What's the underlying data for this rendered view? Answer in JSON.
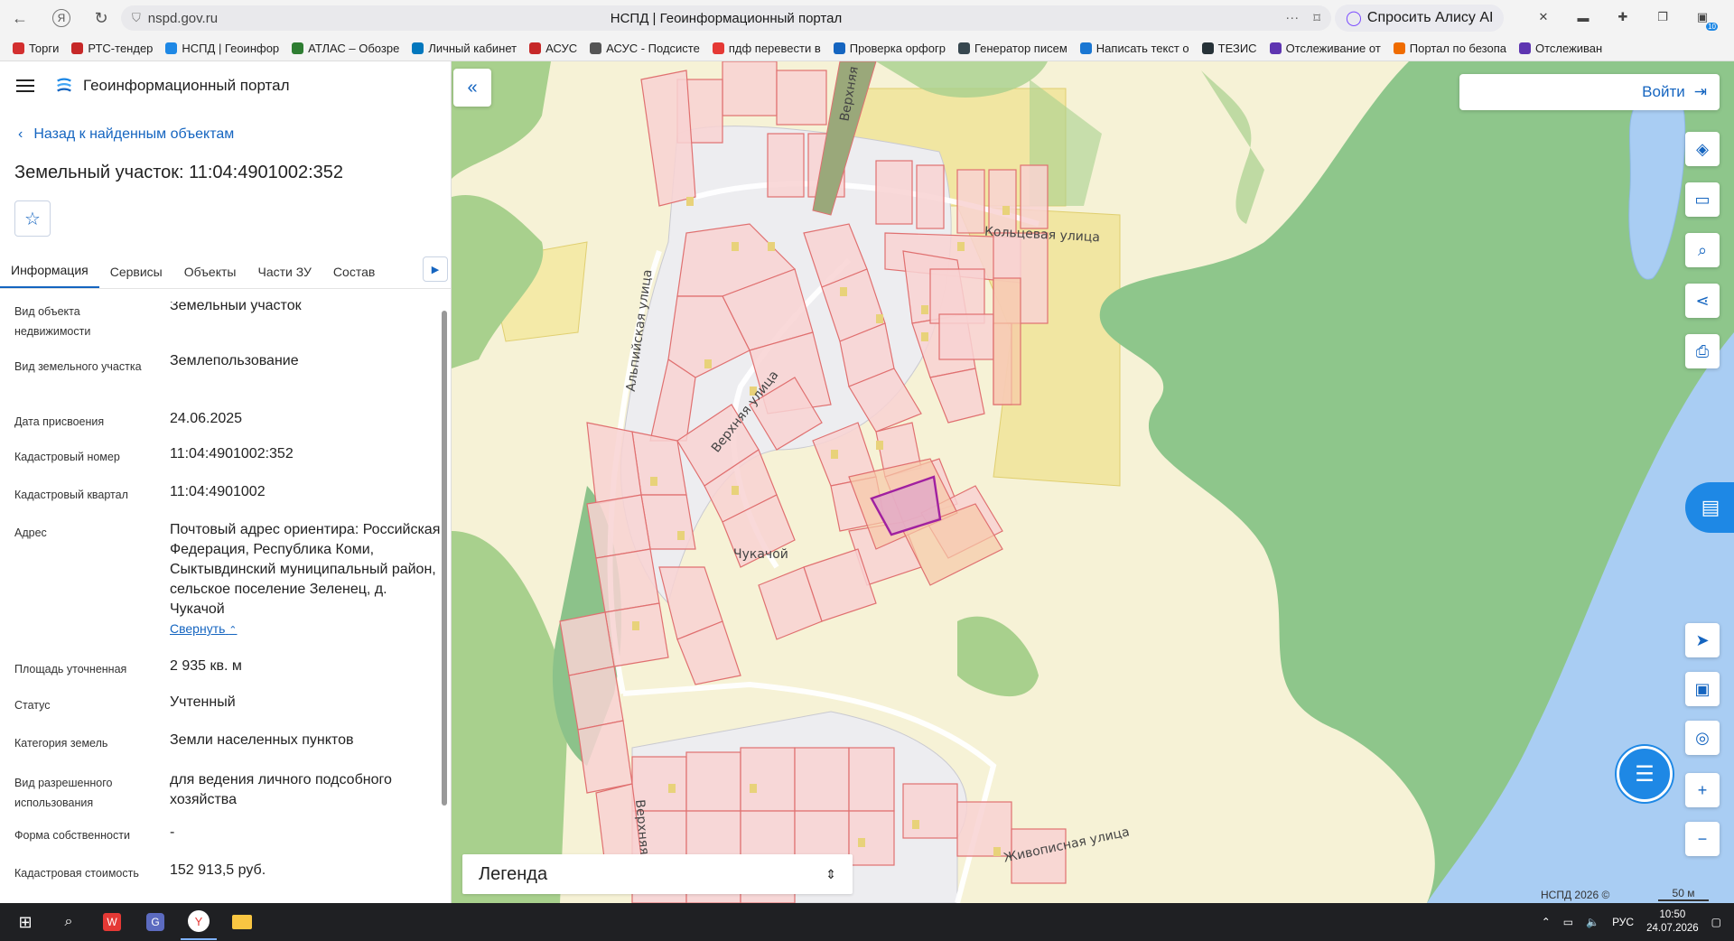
{
  "browser": {
    "url": "nspd.gov.ru",
    "tab_title": "НСПД | Геоинформационный портал",
    "alice_label": "Спросить Алису AI",
    "ext_badge": "10"
  },
  "bookmarks": [
    {
      "label": "Торги",
      "color": "#d32f2f"
    },
    {
      "label": "РТС-тендер",
      "color": "#c62828"
    },
    {
      "label": "НСПД | Геоинфор",
      "color": "#1e88e5"
    },
    {
      "label": "АТЛАС – Обозре",
      "color": "#2e7d32"
    },
    {
      "label": "Личный кабинет",
      "color": "#0277bd"
    },
    {
      "label": "АСУС",
      "color": "#c62828"
    },
    {
      "label": "АСУС - Подсисте",
      "color": "#555555"
    },
    {
      "label": "пдф перевести в",
      "color": "#e53935"
    },
    {
      "label": "Проверка орфогр",
      "color": "#1565c0"
    },
    {
      "label": "Генератор писем",
      "color": "#37474f"
    },
    {
      "label": "Написать текст о",
      "color": "#1976d2"
    },
    {
      "label": "ТЕЗИС",
      "color": "#263238"
    },
    {
      "label": "Отслеживание от",
      "color": "#5e35b1"
    },
    {
      "label": "Портал по безопа",
      "color": "#ef6c00"
    },
    {
      "label": "Отслеживан",
      "color": "#5e35b1"
    }
  ],
  "portal": {
    "title": "Геоинформационный портал",
    "back_label": "Назад к найденным объектам",
    "object_title": "Земельный участок: 11:04:4901002:352"
  },
  "tabs": [
    "Информация",
    "Сервисы",
    "Объекты",
    "Части ЗУ",
    "Состав"
  ],
  "info": {
    "rows": [
      {
        "label": "Вид объекта недвижимости",
        "value": "Земельный участок"
      },
      {
        "label": "Вид земельного участка",
        "value": "Землепользование"
      },
      {
        "label": "Дата присвоения",
        "value": "24.06.2025"
      },
      {
        "label": "Кадастровый номер",
        "value": "11:04:4901002:352"
      },
      {
        "label": "Кадастровый квартал",
        "value": "11:04:4901002"
      },
      {
        "label": "Адрес",
        "value": "Почтовый адрес ориентира: Российская Федерация, Республика Коми, Сыктывдинский муниципальный район, сельское поселение Зеленец, д. Чукачой"
      },
      {
        "label": "Площадь уточненная",
        "value": "2 935 кв. м"
      },
      {
        "label": "Статус",
        "value": "Учтенный"
      },
      {
        "label": "Категория земель",
        "value": "Земли населенных пунктов"
      },
      {
        "label": "Вид разрешенного использования",
        "value": "для ведения личного подсобного хозяйства"
      },
      {
        "label": "Форма собственности",
        "value": "-"
      },
      {
        "label": "Кадастровая стоимость",
        "value": "152 913,5 руб."
      }
    ],
    "collapse_label": "Свернуть"
  },
  "map": {
    "login_label": "Войти",
    "legend_label": "Легенда",
    "copyright": "НСПД 2026 ©",
    "scale": "50 м",
    "street_labels": {
      "koltsevaya": "Кольцевая улица",
      "alpiyskaya": "Альпийская улица",
      "verkhnyaya": "Верхняя улица",
      "verkhnyaya_short": "Верхняя",
      "zhivopisnaya": "Живописная улица",
      "village": "Чукачой"
    },
    "colors": {
      "land": "#f6f2d6",
      "forest": "#a8d08d",
      "forest_dark": "#8cc28a",
      "water": "#a9cdf3",
      "parcel_fill": "#f8d8d8",
      "parcel_stroke": "#e07070",
      "selected_fill": "#e3a9c7",
      "selected_stroke": "#a020a0",
      "yellow_zone": "#f4eaa8"
    }
  },
  "taskbar": {
    "lang": "РУС",
    "time": "10:50",
    "date": "24.07.2026"
  }
}
